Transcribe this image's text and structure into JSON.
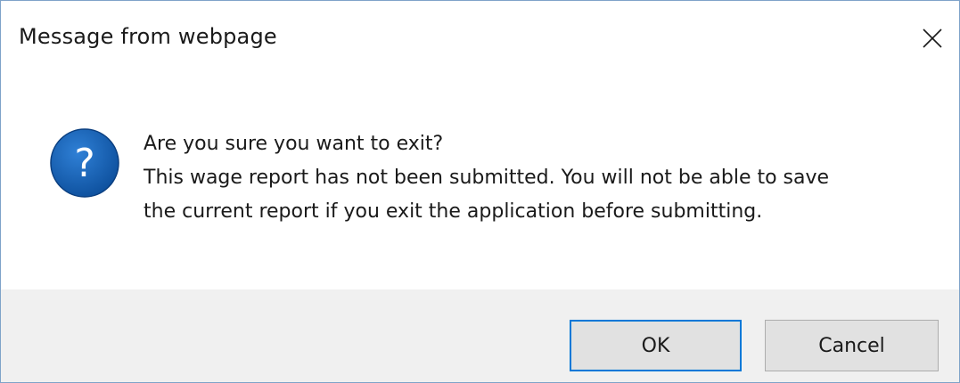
{
  "window": {
    "title": "Message from webpage"
  },
  "icons": {
    "close": "close-icon",
    "question": "question-icon"
  },
  "message": {
    "line1": "Are you sure you want to exit?",
    "line2": "This wage report has not been submitted. You will not be able to save",
    "line3": "the current report if you exit the application before submitting."
  },
  "buttons": {
    "ok_label": "OK",
    "cancel_label": "Cancel"
  },
  "colors": {
    "icon_blue": "#1565c0",
    "focus_border": "#0078d7",
    "footer_bg": "#f0f0f0",
    "button_bg": "#e1e1e1"
  }
}
